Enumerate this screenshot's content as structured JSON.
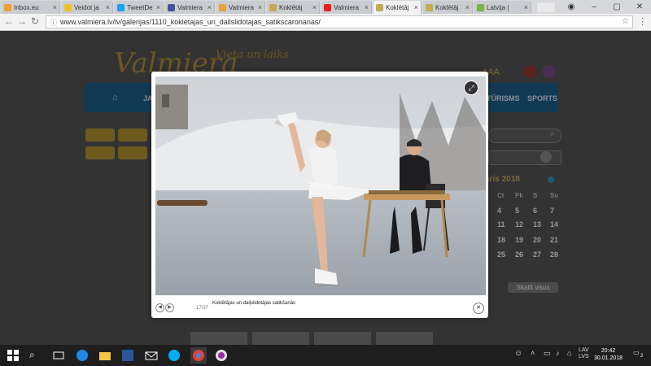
{
  "browser": {
    "tabs": [
      {
        "label": "Inbox.eu",
        "color": "#f0a030",
        "active": false
      },
      {
        "label": "Veidot ja",
        "color": "#f0c020",
        "active": false
      },
      {
        "label": "TweetDe",
        "color": "#1da1f2",
        "active": false
      },
      {
        "label": "Valmiera",
        "color": "#3b5998",
        "active": false
      },
      {
        "label": "Valmiera",
        "color": "#e6a23c",
        "active": false
      },
      {
        "label": "Koklētāj",
        "color": "#c8a850",
        "active": false
      },
      {
        "label": "Valmiera",
        "color": "#e62117",
        "active": false
      },
      {
        "label": "Koklētāj",
        "color": "#c8a850",
        "active": true
      },
      {
        "label": "Koklētāj",
        "color": "#c8a850",
        "active": false
      },
      {
        "label": "Latvija |",
        "color": "#7cb342",
        "active": false
      }
    ],
    "url": "www.valmiera.lv/lv/galerijas/1110_kokletajas_un_dailslidotajas_satikscaronanas/"
  },
  "site": {
    "logo": "Valmiera",
    "logo_tagline": "Vieta un laiks",
    "font_size_label": "AAA",
    "nav": [
      "JA",
      "TŪRISMS",
      "SPORTS"
    ],
    "calendar": {
      "title": "āris 2018",
      "headers": [
        "Ct",
        "Pk",
        "S",
        "Sv"
      ],
      "rows": [
        [
          "4",
          "5",
          "6",
          "7"
        ],
        [
          "11",
          "12",
          "13",
          "14"
        ],
        [
          "18",
          "19",
          "20",
          "21"
        ],
        [
          "25",
          "26",
          "27",
          "28"
        ]
      ]
    },
    "view_all": "Skatīt visus"
  },
  "lightbox": {
    "counter": "17/37",
    "caption": "Koklētājas un daiļslidotājas satikšanās",
    "prev_icon": "chevron-left-icon",
    "next_icon": "chevron-right-icon",
    "close_icon": "close-icon",
    "fullscreen_icon": "fullscreen-icon"
  },
  "taskbar": {
    "language": [
      "LAV",
      "LVS"
    ],
    "time": "20:42",
    "date": "30.01.2018",
    "notifications": "2"
  }
}
